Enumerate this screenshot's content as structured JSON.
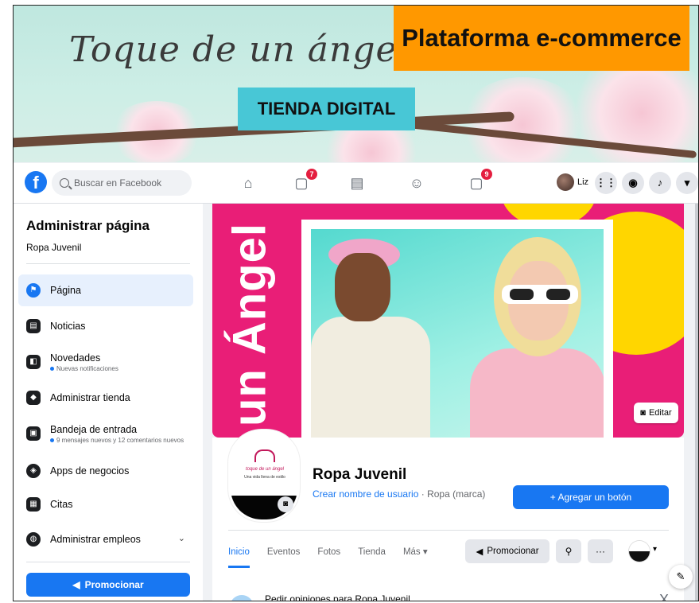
{
  "banner": {
    "script_title": "Toque de un ángel",
    "orange_label": "Plataforma e-commerce",
    "teal_label": "TIENDA DIGITAL"
  },
  "topnav": {
    "search_placeholder": "Buscar en Facebook",
    "notif_badge_1": "7",
    "notif_badge_2": "9",
    "user_name": "Liz"
  },
  "sidebar": {
    "title": "Administrar página",
    "page_name": "Ropa Juvenil",
    "items": [
      {
        "label": "Página",
        "note": ""
      },
      {
        "label": "Noticias",
        "note": ""
      },
      {
        "label": "Novedades",
        "note": "Nuevas notificaciones"
      },
      {
        "label": "Administrar tienda",
        "note": ""
      },
      {
        "label": "Bandeja de entrada",
        "note": "9 mensajes nuevos y 12 comentarios nuevos"
      },
      {
        "label": "Apps de negocios",
        "note": ""
      },
      {
        "label": "Citas",
        "note": ""
      },
      {
        "label": "Administrar empleos",
        "note": ""
      }
    ],
    "promote_label": "Promocionar"
  },
  "cover": {
    "vertical_text": "un Ángel",
    "edit_label": "Editar"
  },
  "profile": {
    "logo_text": "toque de un ángel",
    "logo_tagline": "Una vida llena de estilo",
    "name": "Ropa Juvenil",
    "username_link": "Crear nombre de usuario",
    "category": " · Ropa (marca)",
    "add_button": "+ Agregar un botón"
  },
  "tabs": [
    {
      "label": "Inicio"
    },
    {
      "label": "Eventos"
    },
    {
      "label": "Fotos"
    },
    {
      "label": "Tienda"
    },
    {
      "label": "Más ▾"
    }
  ],
  "actions": {
    "promote_label": "Promocionar",
    "search_icon": "search-icon",
    "more_label": "···"
  },
  "feedback": {
    "text": "Pedir opiniones para Ropa Juvenil",
    "close": "X"
  },
  "colors": {
    "fb_blue": "#1877f2",
    "cover_pink": "#e91e77",
    "cover_yellow": "#ffd600",
    "banner_orange": "#ff9800",
    "banner_teal": "#48c7d6"
  }
}
